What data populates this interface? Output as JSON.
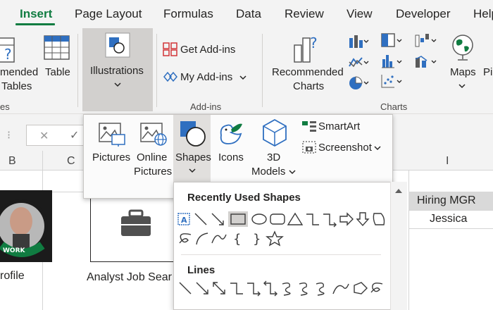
{
  "tabs": {
    "insert": "Insert",
    "page_layout": "Page Layout",
    "formulas": "Formulas",
    "data": "Data",
    "review": "Review",
    "view": "View",
    "developer": "Developer",
    "help_partial": "Help"
  },
  "ribbon": {
    "rec_pivot_line1": "mended",
    "rec_pivot_line2": "Tables",
    "tables_group_partial": "es",
    "table": "Table",
    "illustrations": "Illustrations",
    "get_addins": "Get Add-ins",
    "my_addins": "My Add-ins",
    "addins_group": "Add-ins",
    "recommended_charts_line1": "Recommended",
    "recommended_charts_line2": "Charts",
    "charts_group": "Charts",
    "maps": "Maps",
    "pivotchart_partial": "Pi"
  },
  "illustrations_menu": {
    "pictures": "Pictures",
    "online_line1": "Online",
    "online_line2": "Pictures",
    "shapes": "Shapes",
    "icons": "Icons",
    "models_line1": "3D",
    "models_line2": "Models",
    "smartart": "SmartArt",
    "screenshot": "Screenshot"
  },
  "sheet": {
    "col_b": "B",
    "col_c": "C",
    "col_i": "I",
    "hiring_mgr_header": "Hiring MGR",
    "hiring_mgr_value": "Jessica",
    "profile_partial": "rofile",
    "analyst_text": "Analyst Job Sear",
    "badge_text": "WORK"
  },
  "shapes_gallery": {
    "recent_title": "Recently Used Shapes",
    "lines_title": "Lines"
  },
  "colors": {
    "accent": "#107c41",
    "ribbon_bg": "#f3f3f3",
    "icon_blue": "#2f6fc0"
  }
}
